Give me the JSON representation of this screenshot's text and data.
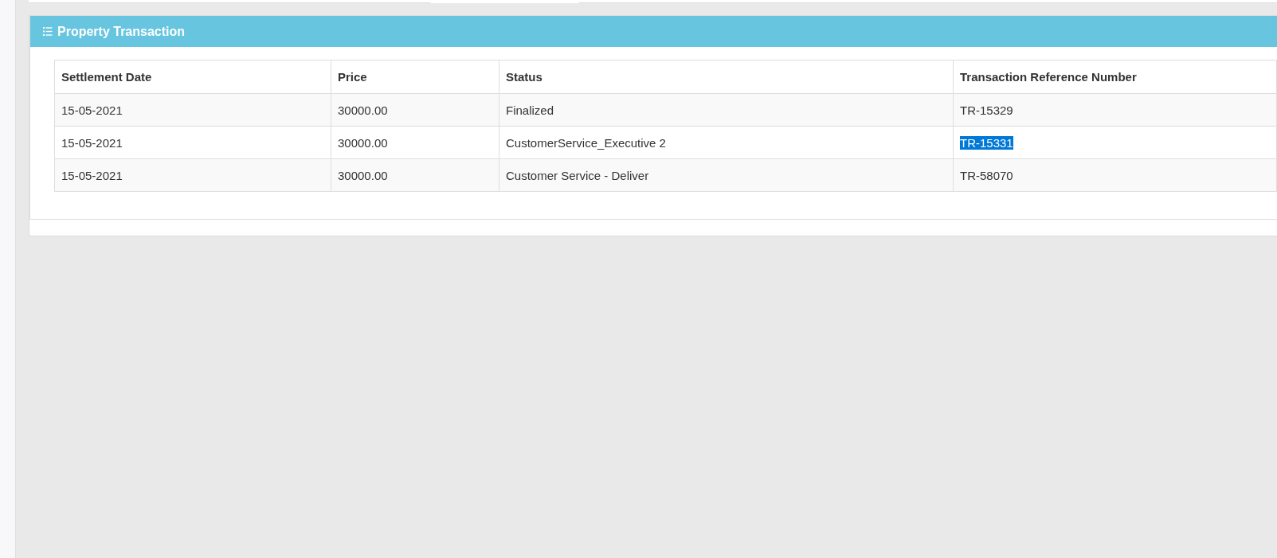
{
  "tabs": [
    {
      "selected": false
    },
    {
      "selected": true
    },
    {
      "selected": false
    }
  ],
  "panel": {
    "title": "Property Transaction",
    "table": {
      "columns": [
        "Settlement Date",
        "Price",
        "Status",
        "Transaction Reference Number"
      ],
      "rows": [
        {
          "settlement_date": "15-05-2021",
          "price": "30000.00",
          "status": "Finalized",
          "reference": "TR-15329",
          "reference_highlighted": false
        },
        {
          "settlement_date": "15-05-2021",
          "price": "30000.00",
          "status": "CustomerService_Executive 2",
          "reference": "TR-15331",
          "reference_highlighted": true
        },
        {
          "settlement_date": "15-05-2021",
          "price": "30000.00",
          "status": "Customer Service - Deliver",
          "reference": "TR-58070",
          "reference_highlighted": false
        }
      ]
    }
  }
}
